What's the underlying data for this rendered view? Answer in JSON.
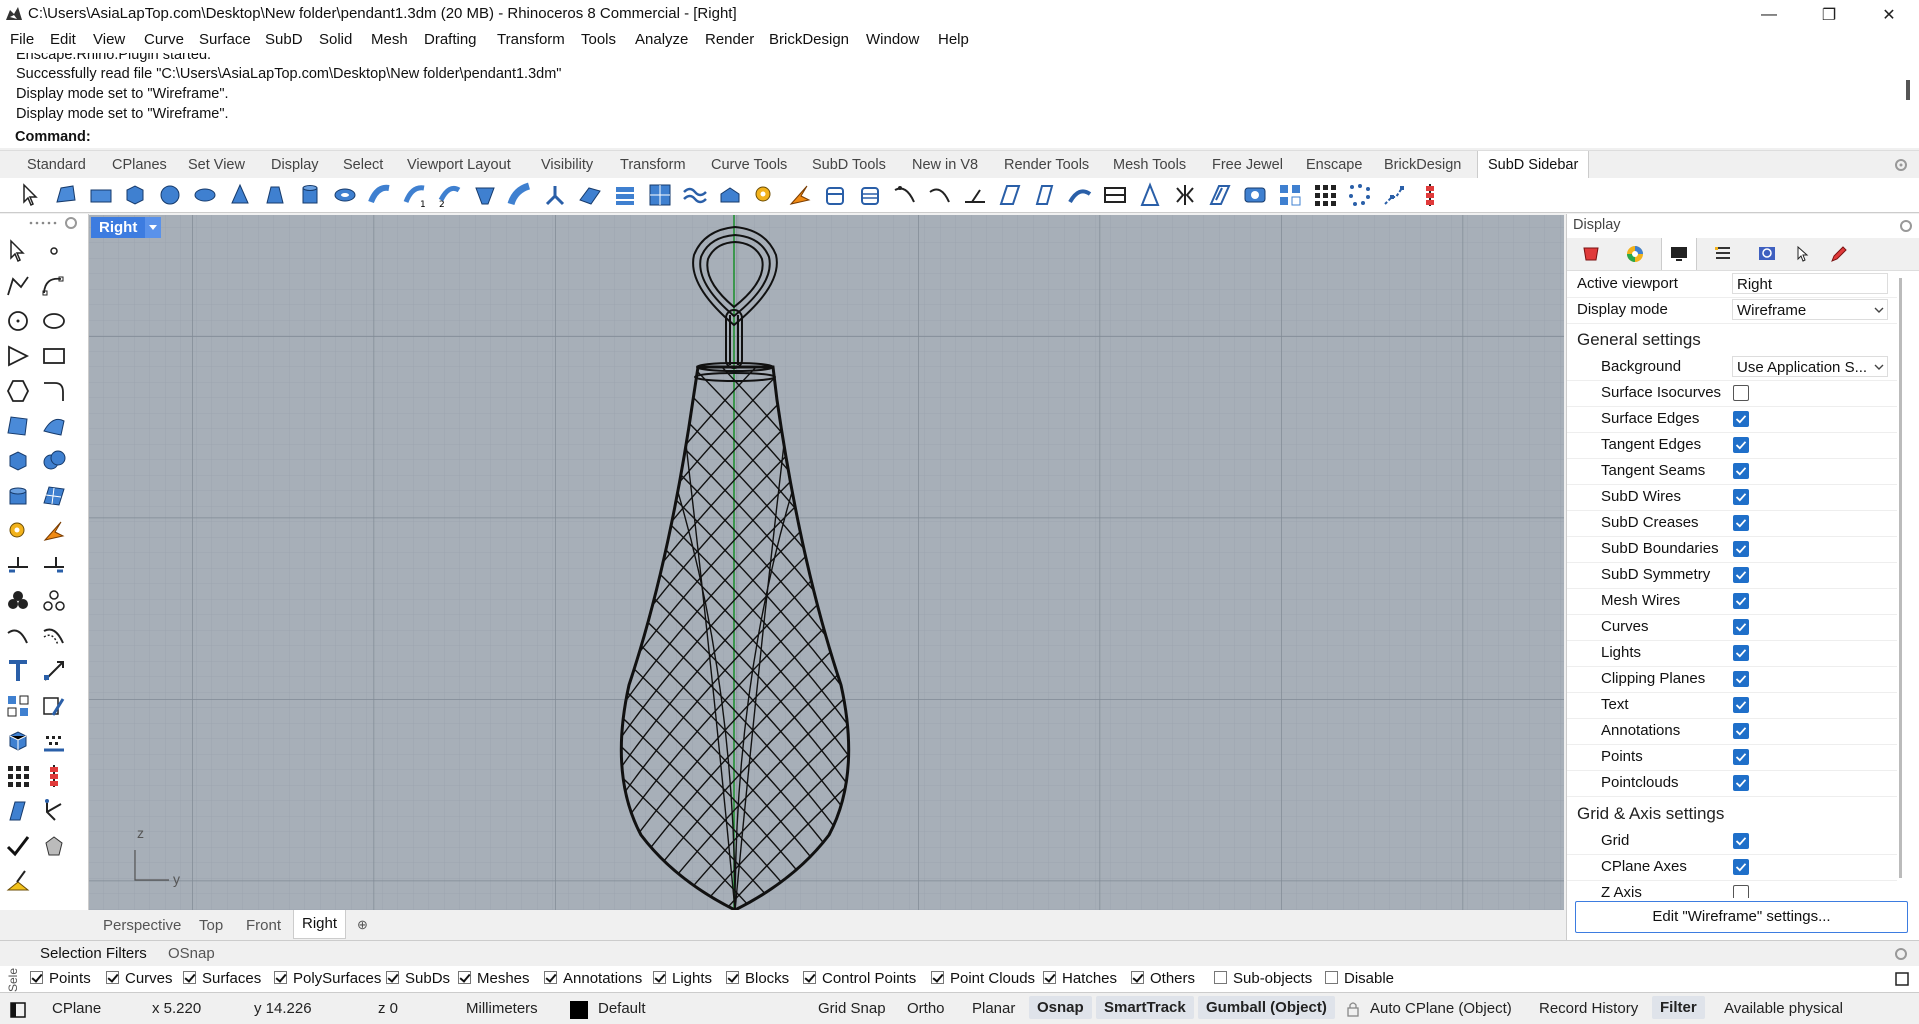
{
  "window": {
    "title": "C:\\Users\\AsiaLapTop.com\\Desktop\\New folder\\pendant1.3dm (20 MB) - Rhinoceros 8 Commercial - [Right]",
    "minimize": "—",
    "restore": "❐",
    "close": "✕"
  },
  "menu": [
    "File",
    "Edit",
    "View",
    "Curve",
    "Surface",
    "SubD",
    "Solid",
    "Mesh",
    "Drafting",
    "Transform",
    "Tools",
    "Analyze",
    "Render",
    "BrickDesign",
    "Window",
    "Help"
  ],
  "history": [
    "Enscape.Rhino.Plugin started.",
    "Successfully read file \"C:\\Users\\AsiaLapTop.com\\Desktop\\New folder\\pendant1.3dm\"",
    "Display mode set to \"Wireframe\".",
    "Display mode set to \"Wireframe\"."
  ],
  "command_label": "Command:",
  "toolbar_tabs": [
    "Standard",
    "CPlanes",
    "Set View",
    "Display",
    "Select",
    "Viewport Layout",
    "Visibility",
    "Transform",
    "Curve Tools",
    "SubD Tools",
    "New in V8",
    "Render Tools",
    "Mesh Tools",
    "Free Jewel",
    "Enscape",
    "BrickDesign",
    "SubD Sidebar"
  ],
  "active_toolbar_tab": "SubD Sidebar",
  "viewport": {
    "name": "Right",
    "axis_z": "z",
    "axis_y": "y",
    "tabs": [
      "Perspective",
      "Top",
      "Front",
      "Right"
    ],
    "active_tab": "Right",
    "add_tab": "⊕"
  },
  "panel": {
    "title": "Display",
    "active_viewport_label": "Active viewport",
    "active_viewport_value": "Right",
    "display_mode_label": "Display mode",
    "display_mode_value": "Wireframe",
    "general_settings": "General settings",
    "background_label": "Background",
    "background_value": "Use Application S...",
    "settings": [
      {
        "label": "Surface Isocurves",
        "checked": false
      },
      {
        "label": "Surface Edges",
        "checked": true
      },
      {
        "label": "Tangent Edges",
        "checked": true
      },
      {
        "label": "Tangent Seams",
        "checked": true
      },
      {
        "label": "SubD Wires",
        "checked": true
      },
      {
        "label": "SubD Creases",
        "checked": true
      },
      {
        "label": "SubD Boundaries",
        "checked": true
      },
      {
        "label": "SubD Symmetry",
        "checked": true
      },
      {
        "label": "Mesh Wires",
        "checked": true
      },
      {
        "label": "Curves",
        "checked": true
      },
      {
        "label": "Lights",
        "checked": true
      },
      {
        "label": "Clipping Planes",
        "checked": true
      },
      {
        "label": "Text",
        "checked": true
      },
      {
        "label": "Annotations",
        "checked": true
      },
      {
        "label": "Points",
        "checked": true
      },
      {
        "label": "Pointclouds",
        "checked": true
      }
    ],
    "grid_axis_settings": "Grid & Axis settings",
    "grid_settings": [
      {
        "label": "Grid",
        "checked": true
      },
      {
        "label": "CPlane Axes",
        "checked": true
      },
      {
        "label": "Z Axis",
        "checked": false
      }
    ],
    "edit_button": "Edit \"Wireframe\" settings..."
  },
  "filter_tabs": [
    "Selection Filters",
    "OSnap"
  ],
  "side_label": "Sele...",
  "filters": [
    {
      "label": "Points",
      "checked": true
    },
    {
      "label": "Curves",
      "checked": true
    },
    {
      "label": "Surfaces",
      "checked": true
    },
    {
      "label": "PolySurfaces",
      "checked": true
    },
    {
      "label": "SubDs",
      "checked": true
    },
    {
      "label": "Meshes",
      "checked": true
    },
    {
      "label": "Annotations",
      "checked": true
    },
    {
      "label": "Lights",
      "checked": true
    },
    {
      "label": "Blocks",
      "checked": true
    },
    {
      "label": "Control Points",
      "checked": true
    },
    {
      "label": "Point Clouds",
      "checked": true
    },
    {
      "label": "Hatches",
      "checked": true
    },
    {
      "label": "Others",
      "checked": true
    },
    {
      "label": "Sub-objects",
      "checked": false
    },
    {
      "label": "Disable",
      "checked": false
    }
  ],
  "status": {
    "cplane": "CPlane",
    "x": "x 5.220",
    "y": "y 14.226",
    "z": "z 0",
    "units": "Millimeters",
    "layer": "Default",
    "grid_snap": "Grid Snap",
    "ortho": "Ortho",
    "planar": "Planar",
    "osnap": "Osnap",
    "smarttrack": "SmartTrack",
    "gumball": "Gumball (Object)",
    "auto_cplane": "Auto CPlane (Object)",
    "record_history": "Record History",
    "filter": "Filter",
    "available": "Available physical"
  }
}
